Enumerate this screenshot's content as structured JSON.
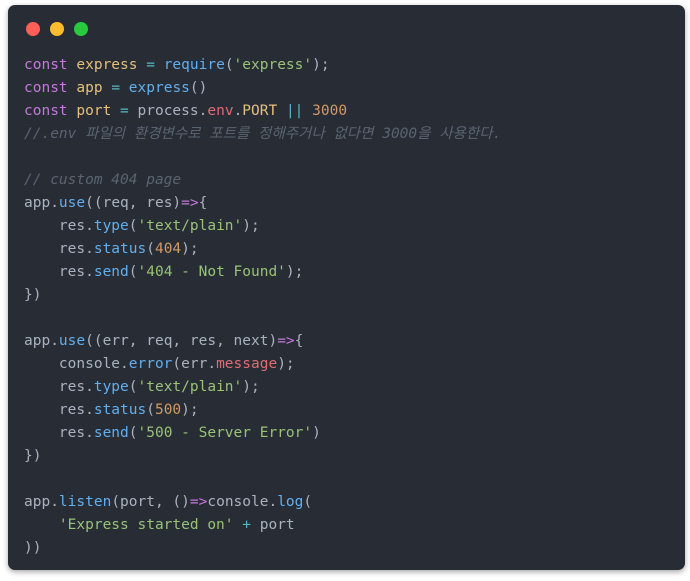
{
  "window": {
    "controls": [
      "close",
      "minimize",
      "maximize"
    ],
    "control_colors": {
      "close": "#ff5f56",
      "minimize": "#ffbd2e",
      "maximize": "#27c93f"
    },
    "background": "#282c34"
  },
  "code": {
    "language": "javascript",
    "theme_colors": {
      "keyword": "#c678dd",
      "variable": "#e5c07b",
      "operator": "#56b6c2",
      "function": "#61afef",
      "string": "#98c379",
      "number": "#d19a66",
      "property": "#e06c75",
      "comment": "#5c6370",
      "plain": "#abb2bf"
    },
    "lines": [
      [
        [
          "kw",
          "const"
        ],
        [
          "pl",
          " "
        ],
        [
          "var",
          "express"
        ],
        [
          "pl",
          " "
        ],
        [
          "op",
          "="
        ],
        [
          "pl",
          " "
        ],
        [
          "fn",
          "require"
        ],
        [
          "pl",
          "("
        ],
        [
          "str",
          "'express'"
        ],
        [
          "pl",
          ");"
        ]
      ],
      [
        [
          "kw",
          "const"
        ],
        [
          "pl",
          " "
        ],
        [
          "var",
          "app"
        ],
        [
          "pl",
          " "
        ],
        [
          "op",
          "="
        ],
        [
          "pl",
          " "
        ],
        [
          "fn",
          "express"
        ],
        [
          "pl",
          "()"
        ]
      ],
      [
        [
          "kw",
          "const"
        ],
        [
          "pl",
          " "
        ],
        [
          "var",
          "port"
        ],
        [
          "pl",
          " "
        ],
        [
          "op",
          "="
        ],
        [
          "pl",
          " process."
        ],
        [
          "prop",
          "env"
        ],
        [
          "pl",
          "."
        ],
        [
          "var",
          "PORT"
        ],
        [
          "pl",
          " "
        ],
        [
          "op",
          "||"
        ],
        [
          "pl",
          " "
        ],
        [
          "num",
          "3000"
        ]
      ],
      [
        [
          "cm",
          "//.env 파일의 환경변수로 포트를 정해주거나 없다면 3000을 사용한다."
        ]
      ],
      [],
      [
        [
          "cm",
          "// custom 404 page"
        ]
      ],
      [
        [
          "pl",
          "app."
        ],
        [
          "fn",
          "use"
        ],
        [
          "pl",
          "((req, res)"
        ],
        [
          "kw",
          "=>"
        ],
        [
          "pl",
          "{"
        ]
      ],
      [
        [
          "pl",
          "    res."
        ],
        [
          "fn",
          "type"
        ],
        [
          "pl",
          "("
        ],
        [
          "str",
          "'text/plain'"
        ],
        [
          "pl",
          ");"
        ]
      ],
      [
        [
          "pl",
          "    res."
        ],
        [
          "fn",
          "status"
        ],
        [
          "pl",
          "("
        ],
        [
          "num",
          "404"
        ],
        [
          "pl",
          ");"
        ]
      ],
      [
        [
          "pl",
          "    res."
        ],
        [
          "fn",
          "send"
        ],
        [
          "pl",
          "("
        ],
        [
          "str",
          "'404 - Not Found'"
        ],
        [
          "pl",
          ");"
        ]
      ],
      [
        [
          "pl",
          "})"
        ]
      ],
      [],
      [
        [
          "pl",
          "app."
        ],
        [
          "fn",
          "use"
        ],
        [
          "pl",
          "((err, req, res, next)"
        ],
        [
          "kw",
          "=>"
        ],
        [
          "pl",
          "{"
        ]
      ],
      [
        [
          "pl",
          "    console."
        ],
        [
          "fn",
          "error"
        ],
        [
          "pl",
          "(err."
        ],
        [
          "prop",
          "message"
        ],
        [
          "pl",
          ");"
        ]
      ],
      [
        [
          "pl",
          "    res."
        ],
        [
          "fn",
          "type"
        ],
        [
          "pl",
          "("
        ],
        [
          "str",
          "'text/plain'"
        ],
        [
          "pl",
          ");"
        ]
      ],
      [
        [
          "pl",
          "    res."
        ],
        [
          "fn",
          "status"
        ],
        [
          "pl",
          "("
        ],
        [
          "num",
          "500"
        ],
        [
          "pl",
          ");"
        ]
      ],
      [
        [
          "pl",
          "    res."
        ],
        [
          "fn",
          "send"
        ],
        [
          "pl",
          "("
        ],
        [
          "str",
          "'500 - Server Error'"
        ],
        [
          "pl",
          ")"
        ]
      ],
      [
        [
          "pl",
          "})"
        ]
      ],
      [],
      [
        [
          "pl",
          "app."
        ],
        [
          "fn",
          "listen"
        ],
        [
          "pl",
          "(port, ()"
        ],
        [
          "kw",
          "=>"
        ],
        [
          "pl",
          "console."
        ],
        [
          "fn",
          "log"
        ],
        [
          "pl",
          "("
        ]
      ],
      [
        [
          "pl",
          "    "
        ],
        [
          "str",
          "'Express started on'"
        ],
        [
          "pl",
          " "
        ],
        [
          "op",
          "+"
        ],
        [
          "pl",
          " port"
        ]
      ],
      [
        [
          "pl",
          "))"
        ]
      ]
    ]
  }
}
